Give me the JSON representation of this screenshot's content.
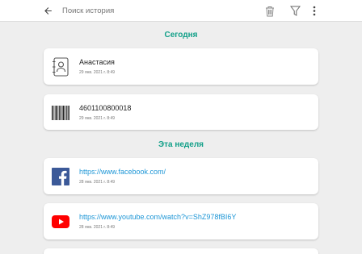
{
  "header": {
    "search_placeholder": "Поиск история",
    "icons": [
      "back-arrow-icon",
      "trash-icon",
      "filter-icon",
      "more-vert-icon"
    ]
  },
  "sections": {
    "today": "Сегодня",
    "this_week": "Эта неделя"
  },
  "items": [
    {
      "icon": "contact-card-icon",
      "title": "Анастасия",
      "date": "29 янв. 2021 г. 8:49"
    },
    {
      "icon": "barcode-icon",
      "title": "4601100800018",
      "date": "29 янв. 2021 г. 8:49"
    },
    {
      "icon": "facebook-icon",
      "title": "https://www.facebook.com/",
      "date": "28 янв. 2021 г. 8:49"
    },
    {
      "icon": "youtube-icon",
      "title": "https://www.youtube.com/watch?v=ShZ978fBI6Y",
      "date": "28 янв. 2021 г. 8:49"
    }
  ],
  "colors": {
    "accent": "#13a089",
    "link": "#1d96d6",
    "facebook": "#3b5998",
    "youtube": "#ff0000"
  }
}
